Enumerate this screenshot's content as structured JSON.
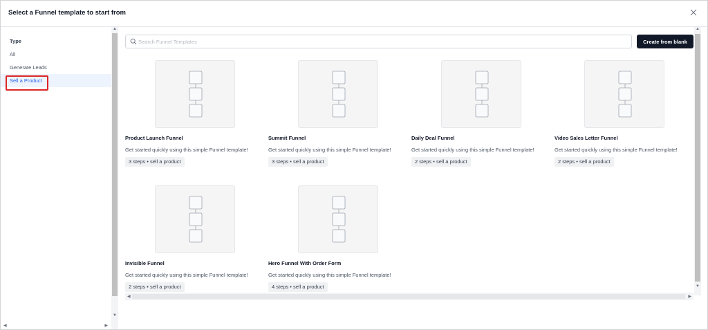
{
  "header": {
    "title": "Select a Funnel template to start from"
  },
  "sidebar": {
    "heading": "Type",
    "items": [
      {
        "label": "All",
        "active": false
      },
      {
        "label": "Generate Leads",
        "active": false
      },
      {
        "label": "Sell a Product",
        "active": true
      }
    ]
  },
  "search": {
    "placeholder": "Search Funnel Templates"
  },
  "toolbar": {
    "create_label": "Create from blank"
  },
  "cards": [
    {
      "title": "Product Launch Funnel",
      "desc": "Get started quickly using this simple Funnel template!",
      "badge": "3 steps • sell a product"
    },
    {
      "title": "Summit Funnel",
      "desc": "Get started quickly using this simple Funnel template!",
      "badge": "3 steps • sell a product"
    },
    {
      "title": "Daily Deal Funnel",
      "desc": "Get started quickly using this simple Funnel template!",
      "badge": "2 steps • sell a product"
    },
    {
      "title": "Video Sales Letter Funnel",
      "desc": "Get started quickly using this simple Funnel template!",
      "badge": "2 steps • sell a product"
    },
    {
      "title": "Invisible Funnel",
      "desc": "Get started quickly using this simple Funnel template!",
      "badge": "2 steps • sell a product"
    },
    {
      "title": "Hero Funnel With Order Form",
      "desc": "Get started quickly using this simple Funnel template!",
      "badge": "4 steps • sell a product"
    }
  ],
  "colors": {
    "accent": "#2563eb",
    "active_bg": "#eef4fd",
    "highlight": "#dc2626",
    "button_bg": "#111827"
  },
  "icons": [
    "close-icon",
    "search-icon",
    "funnel-steps-icon"
  ]
}
